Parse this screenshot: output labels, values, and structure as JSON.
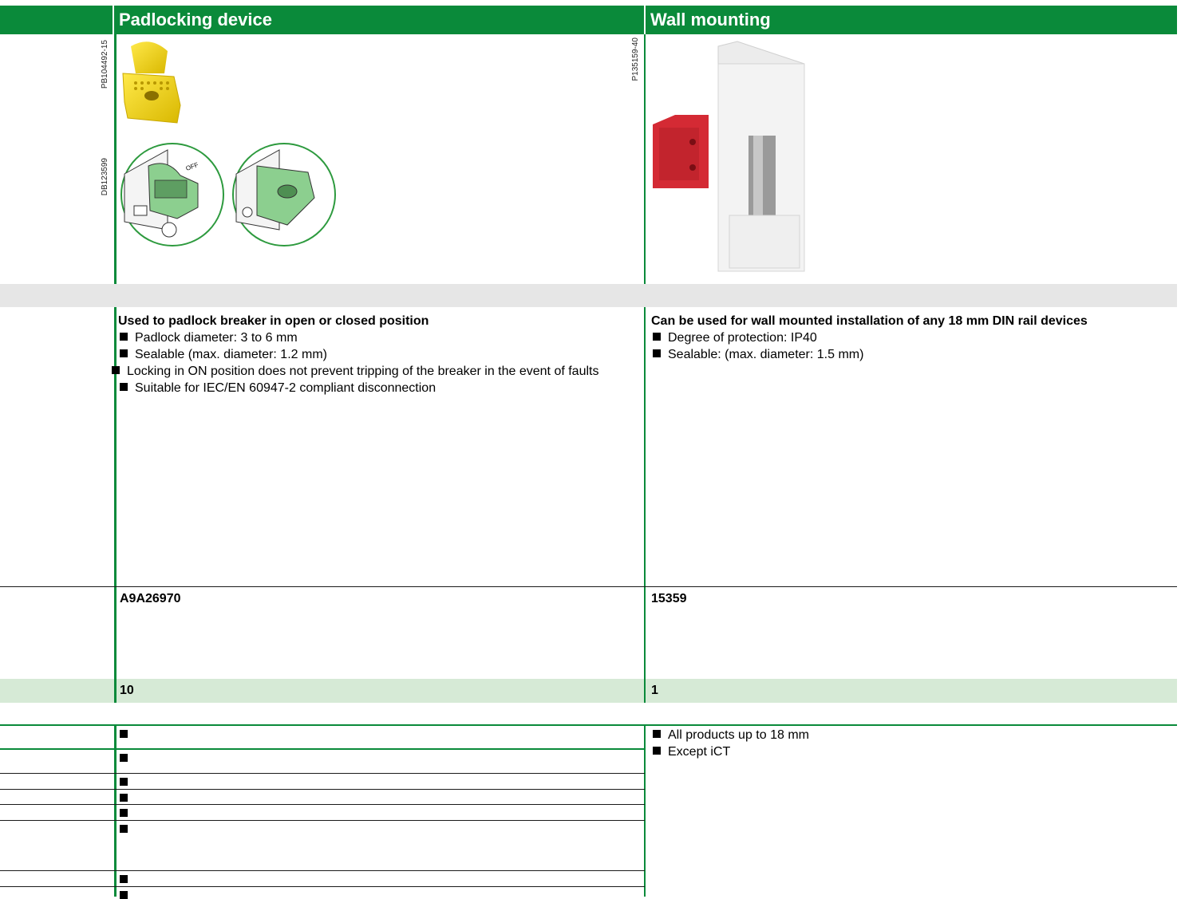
{
  "columns": [
    {
      "header": "Padlocking device",
      "image_codes": [
        "PB104492-15",
        "DB123599"
      ],
      "description_title": "Used to padlock breaker in open or closed position",
      "bullets": [
        "Padlock diameter: 3 to 6 mm",
        "Sealable (max. diameter: 1.2 mm)",
        "Locking in ON position does not prevent tripping of the breaker in the event of faults",
        "Suitable for IEC/EN 60947-2 compliant disconnection"
      ],
      "reference": "A9A26970",
      "quantity": "10"
    },
    {
      "header": "Wall mounting",
      "image_codes": [
        "P135159-40"
      ],
      "description_title": "Can be used for wall mounted installation of any 18 mm DIN rail devices",
      "bullets": [
        "Degree of protection: IP40",
        "Sealable: (max. diameter: 1.5 mm)"
      ],
      "reference": "15359",
      "quantity": "1",
      "compatibility": [
        "All products up to 18 mm",
        "Except iCT"
      ]
    }
  ],
  "colors": {
    "brand_green": "#0a8a3a",
    "gray_band": "#e6e6e6",
    "green_band": "#d6ead6"
  }
}
